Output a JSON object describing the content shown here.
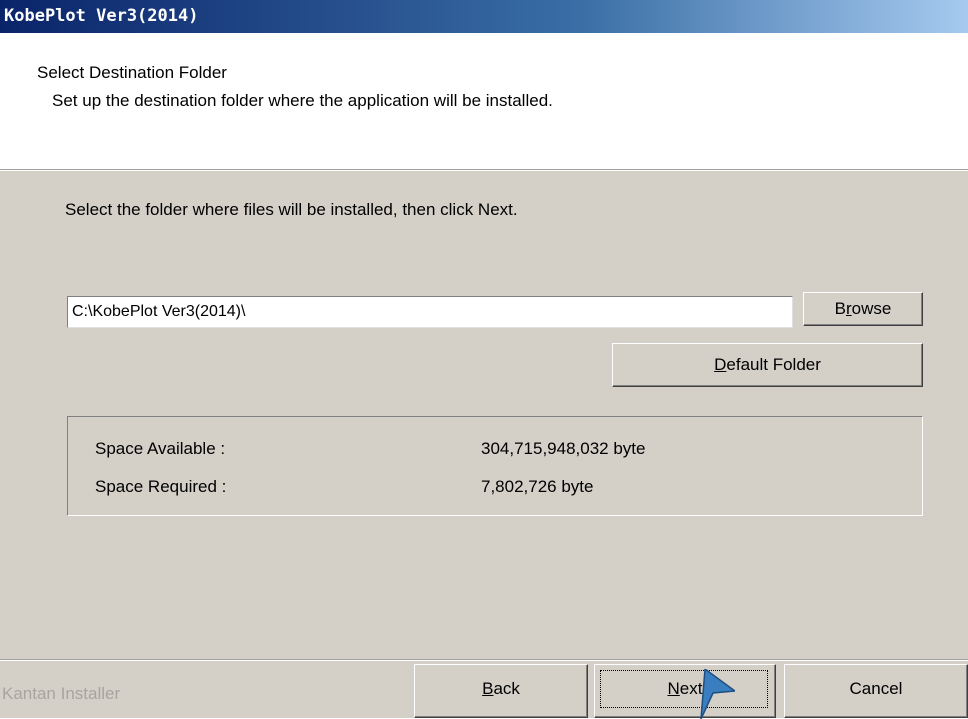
{
  "window": {
    "title": "KobePlot Ver3(2014)"
  },
  "header": {
    "title": "Select Destination Folder",
    "subtitle": "Set up the destination folder where the application will be installed."
  },
  "main": {
    "instruction": "Select the folder where files will be installed, then click Next.",
    "path_value": "C:\\KobePlot Ver3(2014)\\",
    "browse_label": {
      "pre": "B",
      "accel": "r",
      "post": "owse"
    },
    "default_folder_label": {
      "pre": "",
      "accel": "D",
      "post": "efault Folder"
    },
    "space": {
      "available_label": "Space Available :",
      "available_value": "304,715,948,032 byte",
      "required_label": "Space Required :",
      "required_value": "7,802,726 byte"
    }
  },
  "footer": {
    "brand": "Kantan Installer",
    "back_label": {
      "pre": "",
      "accel": "B",
      "post": "ack"
    },
    "next_label": {
      "pre": "",
      "accel": "N",
      "post": "ext"
    },
    "cancel_label": "Cancel"
  },
  "colors": {
    "dialog_face": "#d4d0c8",
    "title_gradient_start": "#0a246a",
    "cursor_accent": "#3a7ec0"
  },
  "icons": {
    "cursor": "pointer-arrow-icon"
  }
}
